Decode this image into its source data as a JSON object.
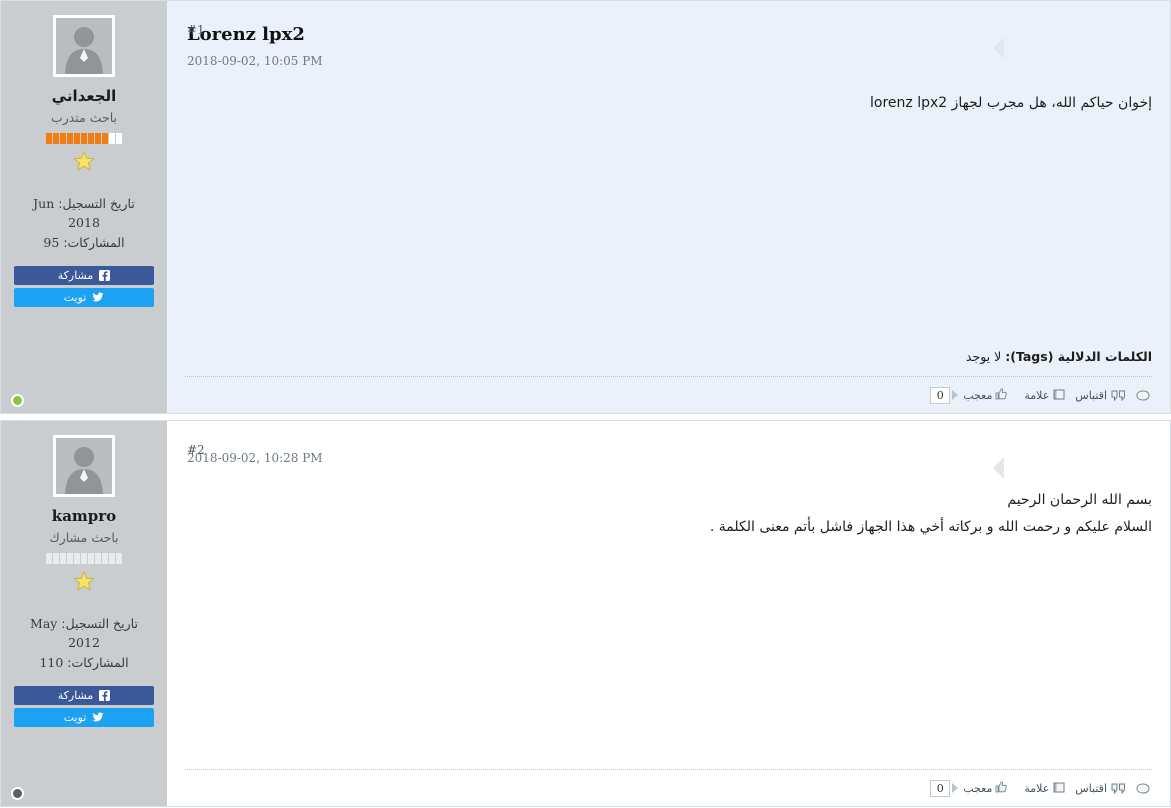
{
  "posts": [
    {
      "number": "#1",
      "title": "Lorenz lpx2",
      "date": "2018-09-02, 10:05 PM",
      "body": [
        "إخوان حياكم الله، هل مجرب لجهاز lorenz lpx2"
      ],
      "tags_label": "الكلمات الدلالية (Tags):",
      "tags_value": "لا يوجد",
      "toolbar": {
        "tag_icon": "tag-icon",
        "quote_label": "اقتباس",
        "quote_icon": "quote-icon",
        "flag_label": "علامة",
        "flag_icon": "flag-icon",
        "like_label": "معجب",
        "like_icon": "thumbs-up-icon",
        "like_count": "0"
      },
      "user": {
        "avatar": "default-avatar-icon",
        "name": "الجعداني",
        "name_is_latin": false,
        "title": "باحث متدرب",
        "rep_filled": 9,
        "rep_total": 11,
        "rep_color": "#f07c12",
        "star_icon": "star-icon",
        "join_label": "تاريخ التسجيل:",
        "join_month": "Jun",
        "join_year": "2018",
        "posts_label": "المشاركات:",
        "posts_count": "95",
        "facebook_label": "مشاركة",
        "twitter_label": "تويت",
        "status": "online"
      }
    },
    {
      "number": "#2",
      "title": "",
      "date": "2018-09-02, 10:28 PM",
      "body": [
        "بسم الله الرحمان الرحيم",
        "السلام عليكم و رحمت الله و بركاته أخي هذا الجهاز فاشل بأتم معنى الكلمة ."
      ],
      "tags_label": "",
      "tags_value": "",
      "toolbar": {
        "tag_icon": "tag-icon",
        "quote_label": "اقتباس",
        "quote_icon": "quote-icon",
        "flag_label": "علامة",
        "flag_icon": "flag-icon",
        "like_label": "معجب",
        "like_icon": "thumbs-up-icon",
        "like_count": "0"
      },
      "user": {
        "avatar": "default-avatar-icon",
        "name": "kampro",
        "name_is_latin": true,
        "title": "باحث مشارك",
        "rep_filled": 0,
        "rep_total": 11,
        "rep_color": "#e9eced",
        "star_icon": "star-icon",
        "join_label": "تاريخ التسجيل:",
        "join_month": "May",
        "join_year": "2012",
        "posts_label": "المشاركات:",
        "posts_count": "110",
        "facebook_label": "مشاركة",
        "twitter_label": "تويت",
        "status": "offline"
      }
    }
  ],
  "colors": {
    "post_alt_bg": "#eaf1fa",
    "post_bg": "#ffffff",
    "sidebar_bg": "#c9cdd0",
    "facebook": "#3b5998",
    "twitter": "#1da1f2",
    "online": "#8cc63f",
    "offline": "#5a5f63",
    "rep_on": "#f07c12"
  }
}
